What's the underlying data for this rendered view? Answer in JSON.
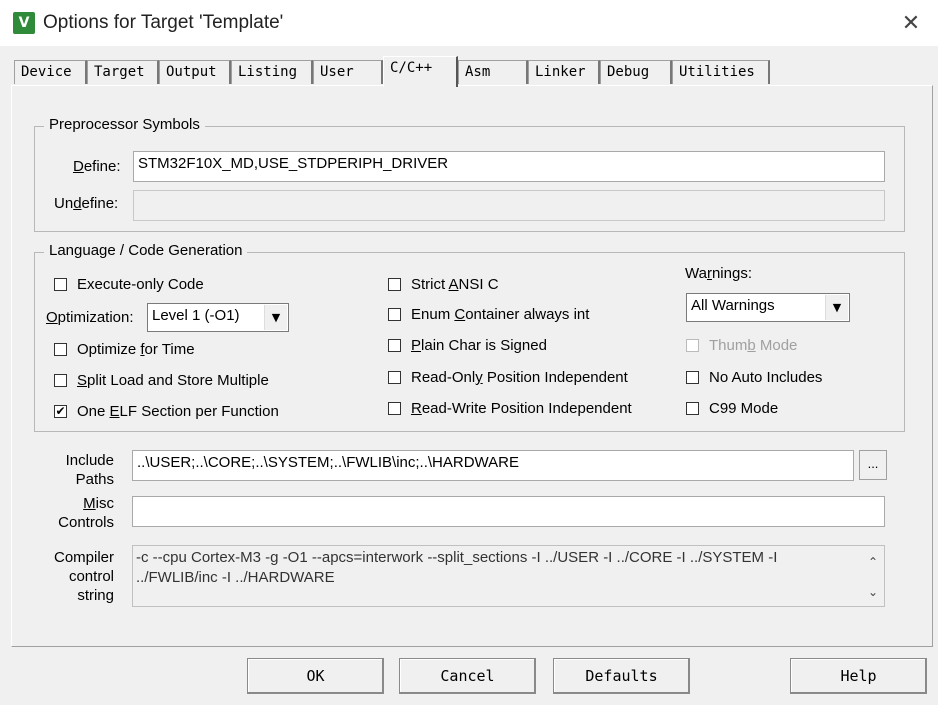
{
  "window": {
    "title": "Options for Target 'Template'",
    "icon_name": "keil-uvision-icon",
    "close_glyph": "✕"
  },
  "tabs": [
    {
      "label": "Device"
    },
    {
      "label": "Target"
    },
    {
      "label": "Output"
    },
    {
      "label": "Listing"
    },
    {
      "label": "User"
    },
    {
      "label": "C/C++"
    },
    {
      "label": "Asm"
    },
    {
      "label": "Linker"
    },
    {
      "label": "Debug"
    },
    {
      "label": "Utilities"
    }
  ],
  "active_tab": "C/C++",
  "preprocessor": {
    "group_title": "Preprocessor Symbols",
    "define_label_u": "D",
    "define_label_rest": "efine:",
    "define_value": "STM32F10X_MD,USE_STDPERIPH_DRIVER",
    "undefine_label_pre": "Un",
    "undefine_label_u": "d",
    "undefine_label_rest": "efine:",
    "undefine_value": ""
  },
  "language": {
    "group_title": "Language / Code Generation",
    "execute_only": {
      "label": "Execute-only Code",
      "checked": false
    },
    "optimization_label_u": "O",
    "optimization_label_rest": "ptimization:",
    "optimization_value": "Level 1 (-O1)",
    "optimize_for_time": {
      "label_pre": "Optimize ",
      "label_u": "f",
      "label_rest": "or Time",
      "checked": false
    },
    "split_load": {
      "label_u": "S",
      "label_rest": "plit Load and Store Multiple",
      "checked": false
    },
    "one_elf": {
      "label_pre": "One ",
      "label_u": "E",
      "label_rest": "LF Section per Function",
      "checked": true
    },
    "strict_ansi": {
      "label_pre": "Strict ",
      "label_u": "A",
      "label_rest": "NSI C",
      "checked": false
    },
    "enum_container": {
      "label_pre": "Enum ",
      "label_u": "C",
      "label_rest": "ontainer always int",
      "checked": false
    },
    "plain_char": {
      "label_u": "P",
      "label_rest": "lain Char is Signed",
      "checked": false
    },
    "read_only_pi": {
      "label_pre": "Read-Onl",
      "label_u": "y",
      "label_rest": " Position Independent",
      "checked": false
    },
    "read_write_pi": {
      "label_u": "R",
      "label_rest": "ead-Write Position Independent",
      "checked": false
    },
    "warnings_label_pre": "Wa",
    "warnings_label_u": "r",
    "warnings_label_rest": "nings:",
    "warnings_value": "All Warnings",
    "thumb_mode": {
      "label_pre": "Thum",
      "label_u": "b",
      "label_rest": " Mode",
      "checked": false,
      "disabled": true
    },
    "no_auto_includes": {
      "label": "No Auto Includes",
      "checked": false
    },
    "c99_mode": {
      "label": "C99 Mode",
      "checked": false
    }
  },
  "include_paths": {
    "label_line1": "Include",
    "label_line2": "Paths",
    "value": "..\\USER;..\\CORE;..\\SYSTEM;..\\FWLIB\\inc;..\\HARDWARE",
    "browse_label": "..."
  },
  "misc_controls": {
    "label_line1_u": "M",
    "label_line1_rest": "isc",
    "label_line2": "Controls",
    "value": ""
  },
  "compiler_control": {
    "label_line1": "Compiler",
    "label_line2": "control",
    "label_line3": "string",
    "line1": "-c --cpu Cortex-M3 -g -O1 --apcs=interwork --split_sections -I ../USER -I ../CORE -I ../SYSTEM -I",
    "line2": "../FWLIB/inc -I ../HARDWARE"
  },
  "buttons": {
    "ok": "OK",
    "cancel": "Cancel",
    "defaults": "Defaults",
    "help": "Help"
  },
  "glyphs": {
    "dropdown": "▼",
    "check": "✔",
    "scroll_up": "⌃",
    "scroll_down": "⌄"
  }
}
